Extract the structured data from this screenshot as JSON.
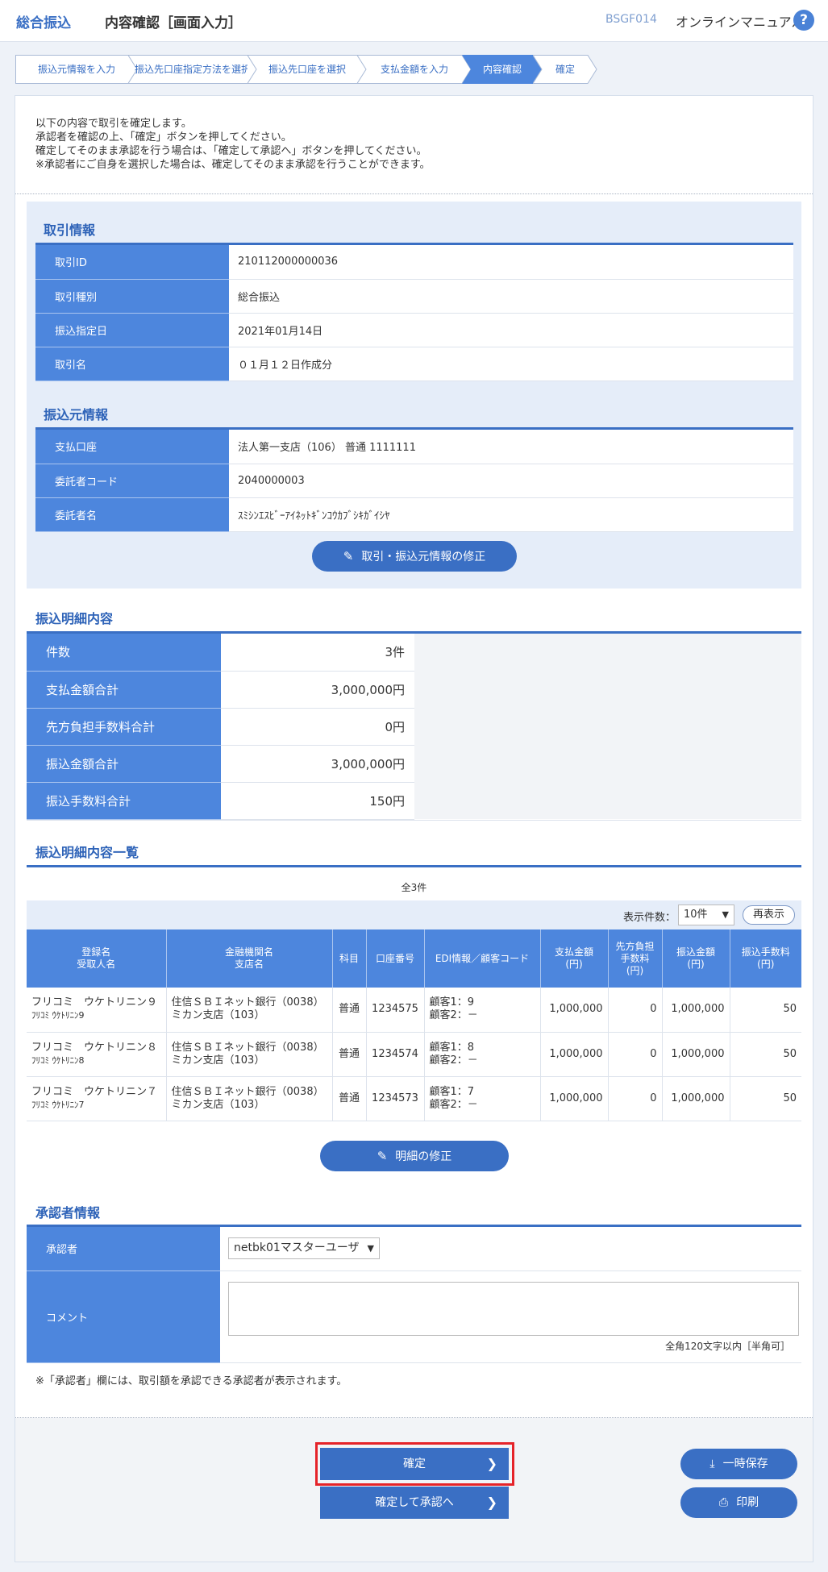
{
  "header": {
    "function_name": "総合振込",
    "screen_title": "内容確認［画面入力］",
    "screen_code": "BSGF014",
    "manual_link": "オンラインマニュアル",
    "help_glyph": "?"
  },
  "steps": [
    {
      "label": "振込元情報を入力",
      "active": false
    },
    {
      "label": "振込先口座指定方法を選択",
      "active": false
    },
    {
      "label": "振込先口座を選択",
      "active": false
    },
    {
      "label": "支払金額を入力",
      "active": false
    },
    {
      "label": "内容確認",
      "active": true
    },
    {
      "label": "確定",
      "active": false
    }
  ],
  "intro": [
    "以下の内容で取引を確定します。",
    "承認者を確認の上、「確定」ボタンを押してください。",
    "確定してそのまま承認を行う場合は、「確定して承認へ」ボタンを押してください。",
    "※承認者にご自身を選択した場合は、確定してそのまま承認を行うことができます。"
  ],
  "transaction": {
    "title": "取引情報",
    "rows": [
      {
        "label": "取引ID",
        "value": "210112000000036"
      },
      {
        "label": "取引種別",
        "value": "総合振込"
      },
      {
        "label": "振込指定日",
        "value": "2021年01月14日"
      },
      {
        "label": "取引名",
        "value": "０１月１２日作成分"
      }
    ]
  },
  "source": {
    "title": "振込元情報",
    "rows": [
      {
        "label": "支払口座",
        "value": "法人第一支店（106） 普通 1111111"
      },
      {
        "label": "委託者コード",
        "value": "2040000003"
      },
      {
        "label": "委託者名",
        "value": "ｽﾐｼﾝｴｽﾋﾞｰｱｲﾈｯﾄｷﾞﾝｺｳｶﾌﾞｼｷｶﾞｲｼﾔ"
      }
    ],
    "edit_button": "取引・振込元情報の修正"
  },
  "summary": {
    "title": "振込明細内容",
    "rows": [
      {
        "label": "件数",
        "value": "3件"
      },
      {
        "label": "支払金額合計",
        "value": "3,000,000円"
      },
      {
        "label": "先方負担手数料合計",
        "value": "0円"
      },
      {
        "label": "振込金額合計",
        "value": "3,000,000円"
      },
      {
        "label": "振込手数料合計",
        "value": "150円"
      }
    ]
  },
  "detail": {
    "title": "振込明細内容一覧",
    "total_count": "全3件",
    "page_size_label": "表示件数：",
    "page_size_value": "10件",
    "redisplay_button": "再表示",
    "headers": [
      [
        "登録名",
        "受取人名"
      ],
      [
        "金融機関名",
        "支店名"
      ],
      [
        "科目"
      ],
      [
        "口座番号"
      ],
      [
        "EDI情報／顧客コード"
      ],
      [
        "支払金額",
        "(円)"
      ],
      [
        "先方負担",
        "手数料",
        "(円)"
      ],
      [
        "振込金額",
        "(円)"
      ],
      [
        "振込手数料",
        "(円)"
      ]
    ],
    "rows": [
      {
        "name": "フリコミ　ウケトリニン９",
        "kana": "ﾌﾘｺﾐ ｳｹﾄﾘﾆﾝ9",
        "bank": "住信ＳＢＩネット銀行（0038）",
        "branch": "ミカン支店（103）",
        "type": "普通",
        "account": "1234575",
        "edi1": "顧客1：9",
        "edi2": "顧客2：－",
        "pay": "1,000,000",
        "fee_payee": "0",
        "transfer": "1,000,000",
        "fee": "50"
      },
      {
        "name": "フリコミ　ウケトリニン８",
        "kana": "ﾌﾘｺﾐ ｳｹﾄﾘﾆﾝ8",
        "bank": "住信ＳＢＩネット銀行（0038）",
        "branch": "ミカン支店（103）",
        "type": "普通",
        "account": "1234574",
        "edi1": "顧客1：8",
        "edi2": "顧客2：－",
        "pay": "1,000,000",
        "fee_payee": "0",
        "transfer": "1,000,000",
        "fee": "50"
      },
      {
        "name": "フリコミ　ウケトリニン７",
        "kana": "ﾌﾘｺﾐ ｳｹﾄﾘﾆﾝ7",
        "bank": "住信ＳＢＩネット銀行（0038）",
        "branch": "ミカン支店（103）",
        "type": "普通",
        "account": "1234573",
        "edi1": "顧客1：7",
        "edi2": "顧客2：－",
        "pay": "1,000,000",
        "fee_payee": "0",
        "transfer": "1,000,000",
        "fee": "50"
      }
    ],
    "edit_button": "明細の修正"
  },
  "approver": {
    "title": "承認者情報",
    "approver_label": "承認者",
    "approver_value": "netbk01マスターユーザ",
    "comment_label": "コメント",
    "comment_value": "",
    "comment_hint": "全角120文字以内［半角可］",
    "note": "※「承認者」欄には、取引額を承認できる承認者が表示されます。"
  },
  "actions": {
    "confirm": "確定",
    "confirm_approve": "確定して承認へ",
    "save": "一時保存",
    "print": "印刷"
  },
  "colors": {
    "accent": "#3a6fc4",
    "header_cell": "#4d86dd",
    "highlight_frame": "#e52329"
  }
}
